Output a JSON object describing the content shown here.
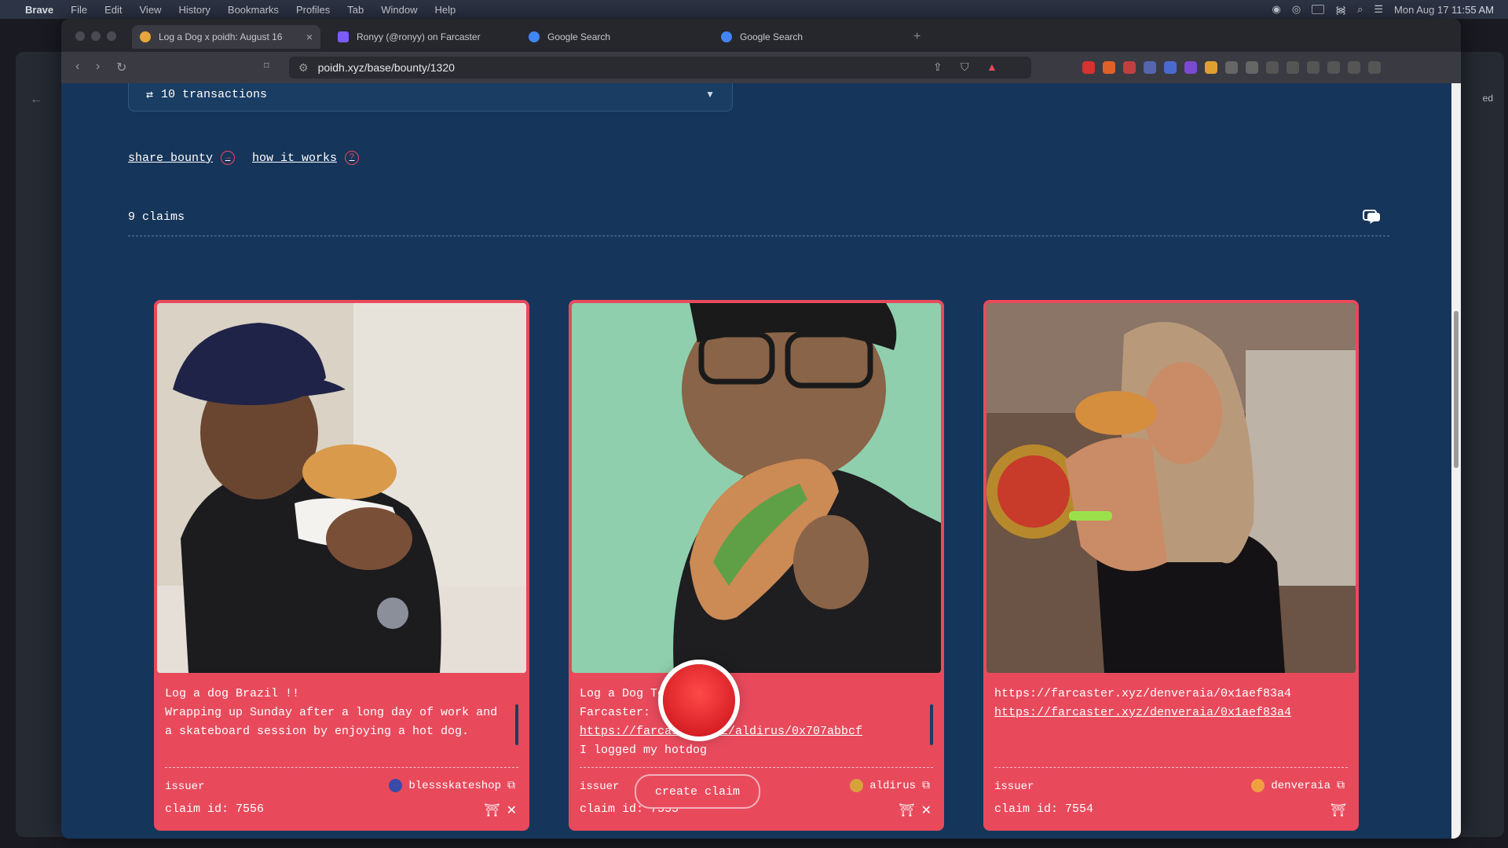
{
  "menubar": {
    "items": [
      "Brave",
      "File",
      "Edit",
      "View",
      "History",
      "Bookmarks",
      "Profiles",
      "Tab",
      "Window",
      "Help"
    ],
    "datetime": "Mon Aug 17  11:55 AM"
  },
  "tabs": [
    {
      "title": "Log a Dog x poidh: August 16",
      "active": true,
      "favicon_color": "#e8a73a"
    },
    {
      "title": "Ronyy (@ronyy) on Farcaster",
      "active": false,
      "favicon_color": "#7b5cff"
    },
    {
      "title": "Google Search",
      "active": false,
      "favicon_color": "#4285f4"
    },
    {
      "title": "Google Search",
      "active": false,
      "favicon_color": "#4285f4"
    }
  ],
  "browser": {
    "url": "poidh.xyz/base/bounty/1320",
    "new_tab": "+",
    "side_label": "ed"
  },
  "bounty": {
    "transactions_label": "10 transactions",
    "share_label": "share bounty",
    "how_label": "how it works",
    "claims_label": "9 claims"
  },
  "claims": [
    {
      "text": "Log a dog Brazil !!\nWrapping up Sunday after a long day of work and a skateboard session by enjoying a hot dog.",
      "issuer_label": "issuer",
      "username": "blessskateshop",
      "claim_id": "claim id: 7556",
      "avatar_color": "#3a4aa8"
    },
    {
      "text_line1": "Log a Dog Today ✏️",
      "text_line2": "Farcaster:",
      "link": "https://farcaster.xyz/aldirus/0x707abbcf",
      "text_line3": "I logged my hotdog",
      "issuer_label": "issuer",
      "username": "aldirus",
      "claim_id": "claim id: 7555",
      "avatar_color": "#d8a23a"
    },
    {
      "link1": "https://farcaster.xyz/denveraia/0x1aef83a4",
      "link2": "https://farcaster.xyz/denveraia/0x1aef83a4",
      "issuer_label": "issuer",
      "username": "denveraia",
      "claim_id": "claim id: 7554",
      "avatar_color": "#f0a040"
    }
  ],
  "create_claim_label": "create claim",
  "colors": {
    "page_bg": "#16355a",
    "card_bg": "#e84a5c",
    "accent_ring": "#e34b5d"
  }
}
